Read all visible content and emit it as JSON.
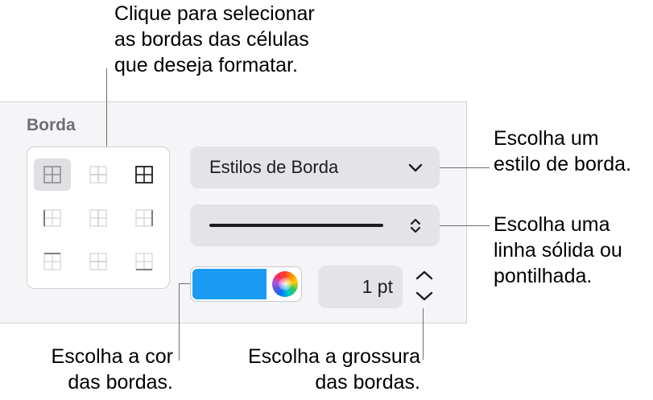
{
  "callouts": {
    "select_borders": [
      "Clique para selecionar",
      "as bordas das células",
      "que deseja formatar."
    ],
    "border_style": [
      "Escolha um",
      "estilo de borda."
    ],
    "line_type": [
      "Escolha uma",
      "linha sólida ou",
      "pontilhada."
    ],
    "border_color": [
      "Escolha a cor",
      "das bordas."
    ],
    "border_thickness": [
      "Escolha a grossura",
      "das bordas."
    ]
  },
  "panel": {
    "title": "Borda",
    "border_style_popup": "Estilos de Borda",
    "line_style": "solid",
    "color_hex": "#1a9cf5",
    "width_value": "1 pt"
  },
  "border_buttons": [
    {
      "icon": "all-borders-icon",
      "selected": true
    },
    {
      "icon": "inner-borders-icon",
      "selected": false
    },
    {
      "icon": "outer-and-inner-borders-icon",
      "selected": false
    },
    {
      "icon": "left-border-icon",
      "selected": false
    },
    {
      "icon": "inner-vertical-border-icon",
      "selected": false
    },
    {
      "icon": "right-border-icon",
      "selected": false
    },
    {
      "icon": "top-border-icon",
      "selected": false
    },
    {
      "icon": "inner-horizontal-border-icon",
      "selected": false
    },
    {
      "icon": "bottom-border-icon",
      "selected": false
    }
  ]
}
